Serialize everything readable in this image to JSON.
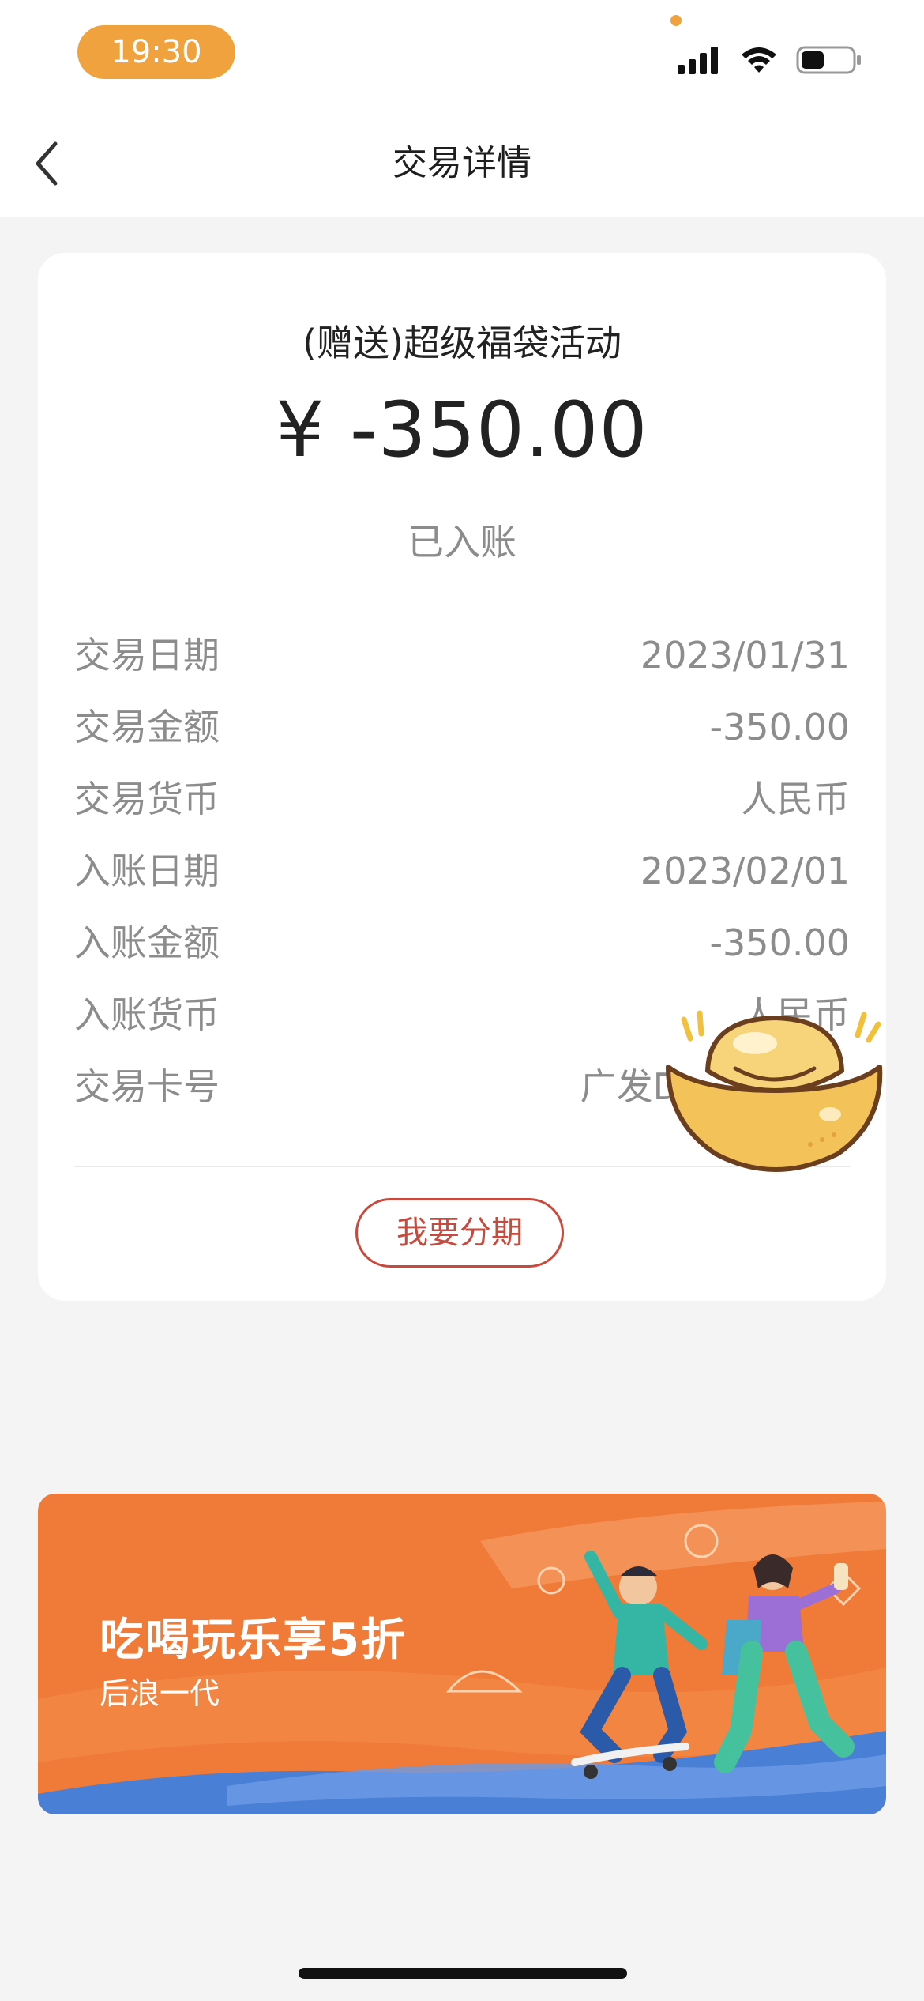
{
  "status_bar": {
    "time": "19:30"
  },
  "nav": {
    "title": "交易详情"
  },
  "transaction": {
    "merchant": "(赠送)超级福袋活动",
    "amount": "¥ -350.00",
    "status": "已入账",
    "details": [
      {
        "label": "交易日期",
        "value": "2023/01/31"
      },
      {
        "label": "交易金额",
        "value": "-350.00"
      },
      {
        "label": "交易货币",
        "value": "人民币"
      },
      {
        "label": "入账日期",
        "value": "2023/02/01"
      },
      {
        "label": "入账金额",
        "value": "-350.00"
      },
      {
        "label": "入账货币",
        "value": "人民币"
      },
      {
        "label": "交易卡号",
        "value": "广发D"
      }
    ],
    "installment_button": "我要分期"
  },
  "banner": {
    "title": "吃喝玩乐享5折",
    "subtitle": "后浪一代"
  },
  "colors": {
    "status_pill": "#f0a23e",
    "accent_red": "#c94a3c",
    "banner_orange": "#f07a37",
    "banner_blue": "#4a7fd6"
  },
  "icons": [
    "signal-icon",
    "wifi-icon",
    "battery-icon",
    "back-chevron-icon",
    "gold-ingot-sticker"
  ]
}
